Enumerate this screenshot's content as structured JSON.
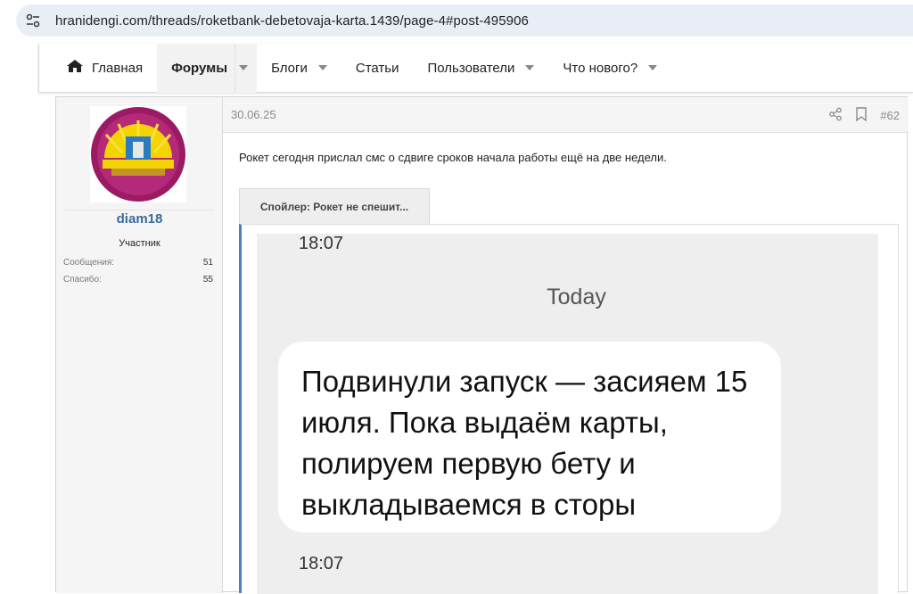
{
  "browser": {
    "url": "hranidengi.com/threads/roketbank-debetovaja-karta.1439/page-4#post-495906"
  },
  "nav": {
    "items": [
      {
        "label": "Главная"
      },
      {
        "label": "Форумы"
      },
      {
        "label": "Блоги"
      },
      {
        "label": "Статьи"
      },
      {
        "label": "Пользователи"
      },
      {
        "label": "Что нового?"
      }
    ]
  },
  "user": {
    "name": "diam18",
    "role": "Участник",
    "stats": [
      {
        "label": "Сообщения:",
        "value": "51"
      },
      {
        "label": "Спасибо:",
        "value": "55"
      }
    ]
  },
  "post": {
    "date": "30.06.25",
    "number": "#62",
    "text": "Рокет сегодня прислал смс о сдвиге сроков начала работы ещё на две недели.",
    "spoiler_label": "Спойлер: Рокет не спешит..."
  },
  "sms": {
    "time_top": "18:07",
    "day": "Today",
    "message": "Подвинули запуск — засияем 15 июля. Пока выдаём карты, полируем первую бету и выкладываемся в сторы",
    "time_bottom": "18:07"
  },
  "colors": {
    "username": "#3a6a9b",
    "spoiler_border": "#4a80c0",
    "avatar_ring": "#9b1a63",
    "avatar_sun": "#f4d400"
  }
}
